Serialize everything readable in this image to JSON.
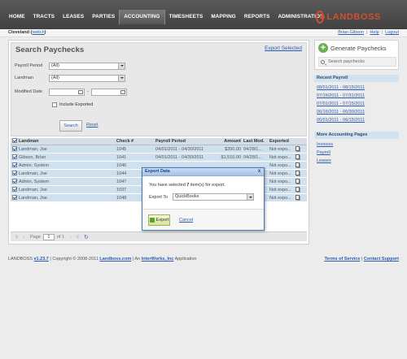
{
  "nav": {
    "items": [
      "HOME",
      "TRACTS",
      "LEASES",
      "PARTIES",
      "ACCOUNTING",
      "TIMESHEETS",
      "MAPPING",
      "REPORTS",
      "ADMINISTRATION"
    ],
    "active": "ACCOUNTING",
    "logo_text": "LANDBOSS"
  },
  "context": {
    "location": "Cleveland",
    "switch_label": "switch",
    "user": "Brian Gibson",
    "help": "Help",
    "logout": "Logout"
  },
  "search": {
    "title": "Search Paychecks",
    "export_selected": "Export Selected",
    "payroll_period_label": "Payroll Period",
    "payroll_period_value": "(All)",
    "landman_label": "Landman",
    "landman_value": "(All)",
    "modified_date_label": "Modified Date",
    "date_sep": "-",
    "include_exported_label": "Include Exported",
    "search_button": "Search",
    "reset_link": "Reset"
  },
  "table": {
    "columns": [
      "Landman",
      "Check #",
      "Payroll Period",
      "Amount",
      "Last Mod.",
      "Exported"
    ],
    "rows": [
      {
        "landman": "Landman, Joe",
        "check": "1045",
        "period": "04/01/2011 - 04/30/2011",
        "amount": "$350.00",
        "lastmod": "04/28/1...",
        "exported": "Not expo..."
      },
      {
        "landman": "Gibson, Brian",
        "check": "1041",
        "period": "04/01/2011 - 04/30/2011",
        "amount": "$1,510.00",
        "lastmod": "04/28/1...",
        "exported": "Not expo..."
      },
      {
        "landman": "Admin, System",
        "check": "1046",
        "period": "",
        "amount": "",
        "lastmod": "",
        "exported": "Not expo..."
      },
      {
        "landman": "Landman, Joe",
        "check": "1044",
        "period": "",
        "amount": "",
        "lastmod": "",
        "exported": "Not expo..."
      },
      {
        "landman": "Admin, System",
        "check": "1047",
        "period": "",
        "amount": "",
        "lastmod": "",
        "exported": "Not expo..."
      },
      {
        "landman": "Landman, Joe",
        "check": "1037",
        "period": "",
        "amount": "",
        "lastmod": "",
        "exported": "Not expo..."
      },
      {
        "landman": "Landman, Joe",
        "check": "1048",
        "period": "",
        "amount": "",
        "lastmod": "",
        "exported": "Not expo..."
      }
    ]
  },
  "pager": {
    "page_label": "Page",
    "page_value": "1",
    "of_label": "of 1"
  },
  "modal": {
    "title": "Export Data",
    "close": "x",
    "message_prefix": "You have selected ",
    "count": "7",
    "message_suffix": " item(s) for export.",
    "export_to_label": "Export To",
    "export_to_value": "QuickBooks",
    "export_button": "Export",
    "cancel_link": "Cancel"
  },
  "sidebar": {
    "generate_title": "Generate Paychecks",
    "search_paychecks": "Search paychecks",
    "recent_payroll_header": "Recent Payroll",
    "recent_payroll": [
      "08/01/2011 - 08/15/2011",
      "07/16/2011 - 07/31/2011",
      "07/01/2011 - 07/15/2011",
      "06/16/2011 - 06/30/2011",
      "06/01/2011 - 06/15/2011"
    ],
    "more_header": "More Accounting Pages",
    "more_links": [
      "Invoices",
      "Payroll",
      "Leases"
    ]
  },
  "footer": {
    "product": "LANDBOSS",
    "version": "v1.23.7",
    "copyright_text": "| Copyright © 2008-2011",
    "site_link": "Landboss.com",
    "all_text": "| An",
    "company_link": "InterWorks, Inc",
    "app_text": "Application",
    "terms": "Terms of Service",
    "contact": "Contact Support"
  },
  "colors": {
    "nav_bg": "#4a4a4a",
    "accent_link": "#2a5db0",
    "logo": "#d05030",
    "row_selected": "#cfe0ee",
    "sidebar_header": "#d3e2ef"
  }
}
